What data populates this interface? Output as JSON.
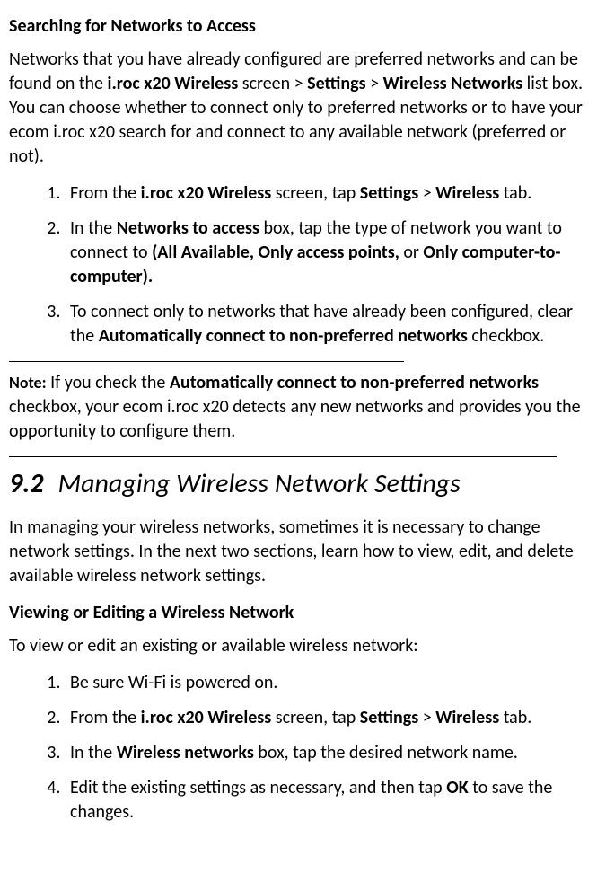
{
  "heading1": "Searching for Networks to Access",
  "para1": {
    "t1": "Networks that you have already configured are preferred networks and can be found on the ",
    "b1": "i.roc x20 Wireless",
    "t2": " screen > ",
    "b2": "Settings",
    "t3": " > ",
    "b3": "Wireless Networks",
    "t4": " list box. You can choose whether to connect only to preferred networks or to have your ecom i.roc x20 search for and connect to any available network (preferred or not)."
  },
  "list1": {
    "item1": {
      "t1": "From the ",
      "b1": "i.roc x20 Wireless",
      "t2": " screen, tap ",
      "b2": "Settings",
      "t3": " > ",
      "b3": "Wireless",
      "t4": " tab."
    },
    "item2": {
      "t1": "In the ",
      "b1": "Networks to access",
      "t2": " box, tap the type of network you want to connect to ",
      "b2": "(All Available, Only access points,",
      "t3": " or ",
      "b3": "Only computer-to-computer)."
    },
    "item3": {
      "t1": "To connect only to networks that have already been configured, clear the ",
      "b1": "Automatically connect to non-preferred networks",
      "t2": " checkbox."
    }
  },
  "note": {
    "label": "Note:",
    "t1": " If you check the ",
    "b1": "Automatically connect to non-preferred networks",
    "t2": " checkbox, your ecom i.roc x20 detects any new networks and provides you the opportunity to configure them."
  },
  "section": {
    "number": "9.2",
    "title": "Managing Wireless Network Settings"
  },
  "para2": "In managing your wireless networks, sometimes it is necessary to change network settings. In the next two sections, learn how to view, edit, and delete available wireless network settings.",
  "heading2": "Viewing or Editing a Wireless Network",
  "para3": "To view or edit an existing or available wireless network:",
  "list2": {
    "item1": "Be sure Wi-Fi is powered on.",
    "item2": {
      "t1": "From the ",
      "b1": "i.roc x20 Wireless",
      "t2": " screen, tap ",
      "b2": "Settings",
      "t3": " > ",
      "b3": "Wireless",
      "t4": " tab."
    },
    "item3": {
      "t1": "In the ",
      "b1": "Wireless networks",
      "t2": " box, tap the desired network name."
    },
    "item4": {
      "t1": "Edit the existing settings as necessary, and then tap ",
      "b1": "OK",
      "t2": " to save the changes."
    }
  }
}
